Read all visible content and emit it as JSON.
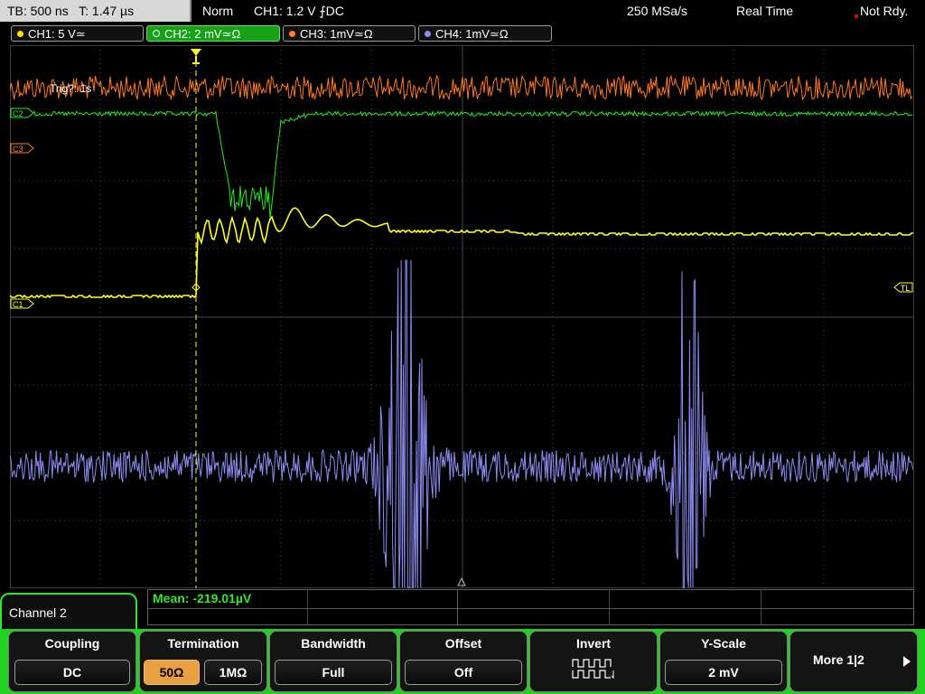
{
  "status_bar": {
    "timebase": "TB: 500 ns",
    "trigger_pos": "T: 1.47 µs",
    "trigger_mode": "Norm",
    "trigger_info": "CH1: 1.2 V ⨍DC",
    "sample_rate": "250 MSa/s",
    "acq_mode": "Real Time",
    "state": "Not Rdy."
  },
  "channel_tabs": [
    {
      "label": "CH1: 5 V≃",
      "color": "#ffe000"
    },
    {
      "label": "CH2: 2 mV≃Ω",
      "color": "#ffffff"
    },
    {
      "label": "CH3: 1mV≃Ω",
      "color": "#ff8020"
    },
    {
      "label": "CH4: 1mV≃Ω",
      "color": "#8c8cf0"
    }
  ],
  "plot": {
    "trigger_time_label": "Trig?: 1s",
    "ch2_marker": "C2",
    "ch3_marker": "C3",
    "ch1_marker": "C1",
    "trigger_level_marker": "TL",
    "colors": {
      "ch1": "#ffff20",
      "ch2": "#22ee22",
      "ch3": "#ff7a20",
      "ch4": "#8c8cf0",
      "grid": "#4a4a4a"
    }
  },
  "measurement": {
    "mean": "Mean: -219.01µV"
  },
  "menu": {
    "title": "Channel 2",
    "coupling_label": "Coupling",
    "coupling_value": "DC",
    "termination_label": "Termination",
    "termination_50": "50Ω",
    "termination_1m": "1MΩ",
    "bandwidth_label": "Bandwidth",
    "bandwidth_value": "Full",
    "offset_label": "Offset",
    "offset_value": "Off",
    "invert_label": "Invert",
    "yscale_label": "Y-Scale",
    "yscale_value": "2 mV",
    "more_label": "More 1|2"
  }
}
